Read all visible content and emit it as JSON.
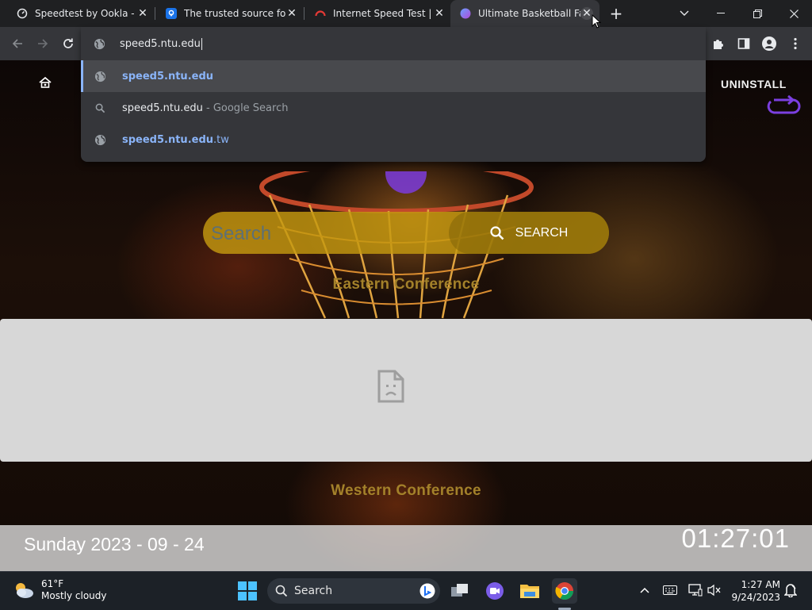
{
  "browser": {
    "tabs": [
      {
        "title": "Speedtest by Ookla - Th",
        "icon": "speedtest-icon",
        "active": false
      },
      {
        "title": "The trusted source for I",
        "icon": "location-pin-icon",
        "active": false
      },
      {
        "title": "Internet Speed Test | Fa",
        "icon": "fast-speed-icon",
        "active": false
      },
      {
        "title": "Ultimate Basketball Fan",
        "icon": "basketball-icon",
        "active": true
      }
    ],
    "omnibox": {
      "value": "speed5.ntu.edu",
      "suggestions": [
        {
          "type": "url",
          "bold": "speed5.ntu.edu",
          "rest": "",
          "suffix": ""
        },
        {
          "type": "search",
          "bold": "speed5.ntu.edu",
          "rest": "",
          "suffix": " - Google Search"
        },
        {
          "type": "url",
          "bold": "speed5.ntu.edu",
          "rest": ".tw",
          "suffix": ""
        }
      ]
    }
  },
  "page": {
    "uninstall_label": "UNINSTALL",
    "search_placeholder": "Search",
    "search_button_label": "SEARCH",
    "eastern_conference": "Eastern Conference",
    "western_conference": "Western Conference",
    "date_text": "Sunday 2023 - 09 - 24",
    "clock_text": "01:27:01"
  },
  "taskbar": {
    "weather_temp": "61°F",
    "weather_desc": "Mostly cloudy",
    "search_label": "Search",
    "time": "1:27 AM",
    "date": "9/24/2023"
  },
  "colors": {
    "link": "#8ab4f8",
    "search_bar": "#c49810",
    "conference_text": "#a3812a"
  }
}
